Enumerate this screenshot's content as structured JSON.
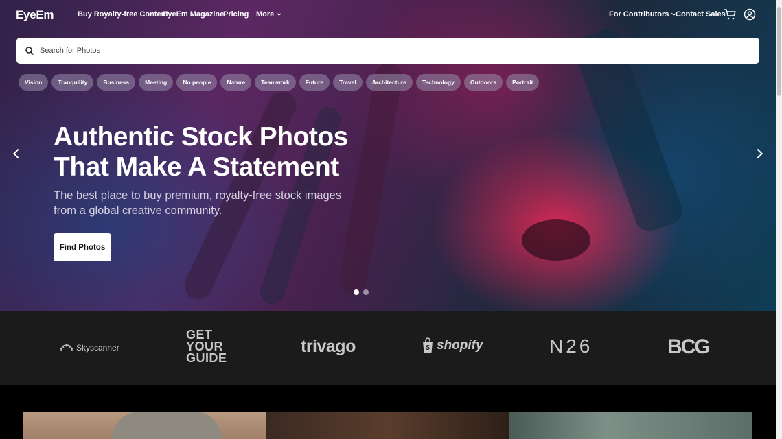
{
  "nav": {
    "logo": "EyeEm",
    "links": [
      "Buy Royalty-free Content",
      "EyeEm Magazine",
      "Pricing",
      "More"
    ],
    "contributors": "For Contributors",
    "contact": "Contact Sales"
  },
  "search": {
    "placeholder": "Search for Photos"
  },
  "tags": [
    "Vision",
    "Tranquility",
    "Business",
    "Meeting",
    "No people",
    "Nature",
    "Teamwork",
    "Future",
    "Travel",
    "Architecture",
    "Technology",
    "Outdoors",
    "Portrait"
  ],
  "hero": {
    "headline_1": "Authentic Stock Photos",
    "headline_2": "That Make A Statement",
    "subline": "The best place to buy premium, royalty-free stock images from a global creative community.",
    "cta": "Find Photos"
  },
  "brands": {
    "skyscanner": "Skyscanner",
    "gyg_1": "GET",
    "gyg_2": "YOUR",
    "gyg_3": "GUIDE",
    "trivago": "trivago",
    "shopify": "shopify",
    "n26": "N26",
    "bcg": "BCG"
  },
  "icons": {
    "cart": "cart-icon",
    "account": "user-circle-icon",
    "search": "search-icon"
  },
  "colors": {
    "brand_band": "#1b1b1b",
    "cta_bg": "#ffffff"
  }
}
